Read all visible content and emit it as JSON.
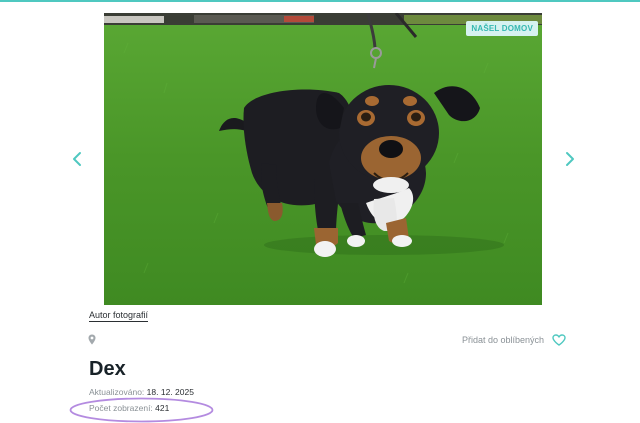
{
  "gallery": {
    "badge": "NAŠEL DOMOV",
    "prev_icon": "chevron-left-icon",
    "next_icon": "chevron-right-icon"
  },
  "photo_author_link": "Autor fotografií",
  "location_icon": "map-pin-icon",
  "favorite": {
    "label": "Přidat do oblíbených",
    "icon": "heart-outline-icon"
  },
  "pet": {
    "name": "Dex",
    "updated_label": "Aktualizováno:",
    "updated_value": "18. 12. 2025",
    "views_label": "Počet zobrazení:",
    "views_value": "421"
  },
  "colors": {
    "accent": "#4fc8c0",
    "annotation": "#b48be0",
    "grass": "#4e9a2b"
  }
}
